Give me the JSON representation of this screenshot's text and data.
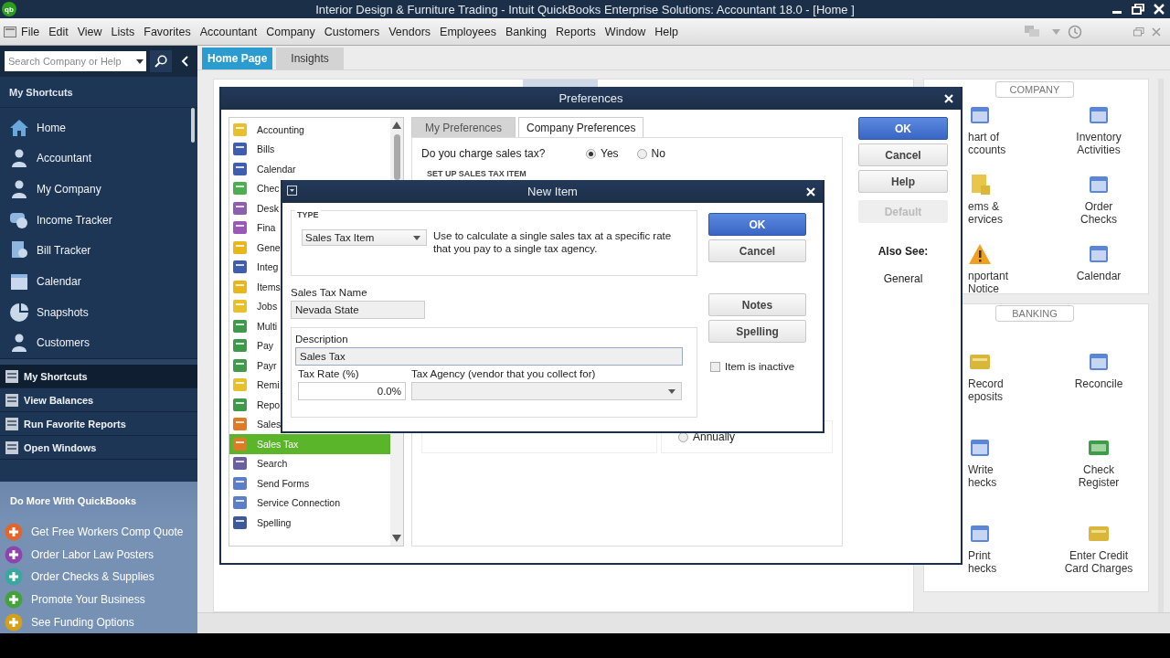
{
  "window": {
    "logo": "qb",
    "title": "Interior Design & Furniture Trading  - Intuit QuickBooks Enterprise Solutions: Accountant 18.0 - [Home ]"
  },
  "menu": [
    "File",
    "Edit",
    "View",
    "Lists",
    "Favorites",
    "Accountant",
    "Company",
    "Customers",
    "Vendors",
    "Employees",
    "Banking",
    "Reports",
    "Window",
    "Help"
  ],
  "sidebar": {
    "search": {
      "placeholder": "Search Company or Help"
    },
    "shortcuts_title": "My Shortcuts",
    "shortcuts": [
      {
        "label": "Home"
      },
      {
        "label": "Accountant"
      },
      {
        "label": "My Company"
      },
      {
        "label": "Income Tracker"
      },
      {
        "label": "Bill Tracker"
      },
      {
        "label": "Calendar"
      },
      {
        "label": "Snapshots"
      },
      {
        "label": "Customers"
      }
    ],
    "sections": [
      {
        "label": "My Shortcuts",
        "selected": true
      },
      {
        "label": "View Balances",
        "selected": false
      },
      {
        "label": "Run Favorite Reports",
        "selected": false
      },
      {
        "label": "Open Windows",
        "selected": false
      }
    ],
    "promo_title": "Do More With QuickBooks",
    "promos": [
      {
        "label": "Get Free Workers Comp Quote"
      },
      {
        "label": "Order Labor Law Posters"
      },
      {
        "label": "Order Checks & Supplies"
      },
      {
        "label": "Promote Your Business"
      },
      {
        "label": "See Funding Options"
      }
    ]
  },
  "tabs": [
    {
      "label": "Home Page",
      "selected": true
    },
    {
      "label": "Insights",
      "selected": false
    }
  ],
  "home": {
    "sections": [
      {
        "title": "COMPANY",
        "items": [
          {
            "lines": [
              "hart of",
              "ccounts"
            ]
          },
          {
            "lines": [
              "Inventory",
              "Activities"
            ]
          },
          {
            "lines": [
              "ems &",
              "ervices"
            ]
          },
          {
            "lines": [
              "Order",
              "Checks"
            ]
          },
          {
            "lines": [
              "nportant",
              "Notice"
            ]
          },
          {
            "lines": [
              "Calendar"
            ]
          }
        ]
      },
      {
        "title": "BANKING",
        "items": [
          {
            "lines": [
              "Record",
              "eposits"
            ]
          },
          {
            "lines": [
              "Reconcile"
            ]
          },
          {
            "lines": [
              "Write",
              "hecks"
            ]
          },
          {
            "lines": [
              "Check",
              "Register"
            ]
          },
          {
            "lines": [
              "Print",
              "hecks"
            ]
          },
          {
            "lines": [
              "Enter Credit",
              "Card Charges"
            ]
          }
        ]
      }
    ]
  },
  "preferences": {
    "title": "Preferences",
    "categories": [
      {
        "label": "Accounting",
        "selected": false
      },
      {
        "label": "Bills",
        "selected": false
      },
      {
        "label": "Calendar",
        "selected": false
      },
      {
        "label": "Chec",
        "selected": false
      },
      {
        "label": "Desk",
        "selected": false
      },
      {
        "label": "Fina",
        "selected": false
      },
      {
        "label": "Gene",
        "selected": false
      },
      {
        "label": "Integ",
        "selected": false
      },
      {
        "label": "Items",
        "selected": false
      },
      {
        "label": "Jobs",
        "selected": false
      },
      {
        "label": "Multi",
        "selected": false
      },
      {
        "label": "Pay",
        "selected": false
      },
      {
        "label": "Payr",
        "selected": false
      },
      {
        "label": "Remi",
        "selected": false
      },
      {
        "label": "Repo",
        "selected": false
      },
      {
        "label": "Sales",
        "selected": false
      },
      {
        "label": "Sales Tax",
        "selected": true
      },
      {
        "label": "Search",
        "selected": false
      },
      {
        "label": "Send Forms",
        "selected": false
      },
      {
        "label": "Service Connection",
        "selected": false
      },
      {
        "label": "Spelling",
        "selected": false
      }
    ],
    "tabs": [
      {
        "label": "My Preferences",
        "selected": false
      },
      {
        "label": "Company Preferences",
        "selected": true
      }
    ],
    "question": "Do you charge sales tax?",
    "options": [
      {
        "label": "Yes",
        "selected": true
      },
      {
        "label": "No",
        "selected": false
      }
    ],
    "group_title": "SET UP SALES TAX ITEM",
    "frequency_options": [
      {
        "label": "Annually",
        "selected": false
      }
    ],
    "buttons": [
      {
        "label": "OK",
        "primary": true,
        "disabled": false
      },
      {
        "label": "Cancel",
        "primary": false,
        "disabled": false
      },
      {
        "label": "Help",
        "primary": false,
        "disabled": false
      },
      {
        "label": "Default",
        "primary": false,
        "disabled": true
      }
    ],
    "also_see_title": "Also See:",
    "also_see": [
      "General"
    ]
  },
  "new_item": {
    "title": "New Item",
    "type_label": "TYPE",
    "type_value": "Sales Tax Item",
    "type_description": "Use to calculate a single sales tax at a specific rate that you pay to a single tax agency.",
    "name_label": "Sales Tax Name",
    "name_value": "Nevada State",
    "description_label": "Description",
    "description_value": "Sales Tax",
    "rate_label": "Tax Rate (%)",
    "rate_value": "0.0%",
    "agency_label": "Tax Agency (vendor that you collect for)",
    "buttons": [
      {
        "label": "OK",
        "primary": true
      },
      {
        "label": "Cancel",
        "primary": false
      },
      {
        "label": "Notes",
        "primary": false
      },
      {
        "label": "Spelling",
        "primary": false
      }
    ],
    "inactive": {
      "label": "Item is inactive",
      "checked": false
    }
  }
}
